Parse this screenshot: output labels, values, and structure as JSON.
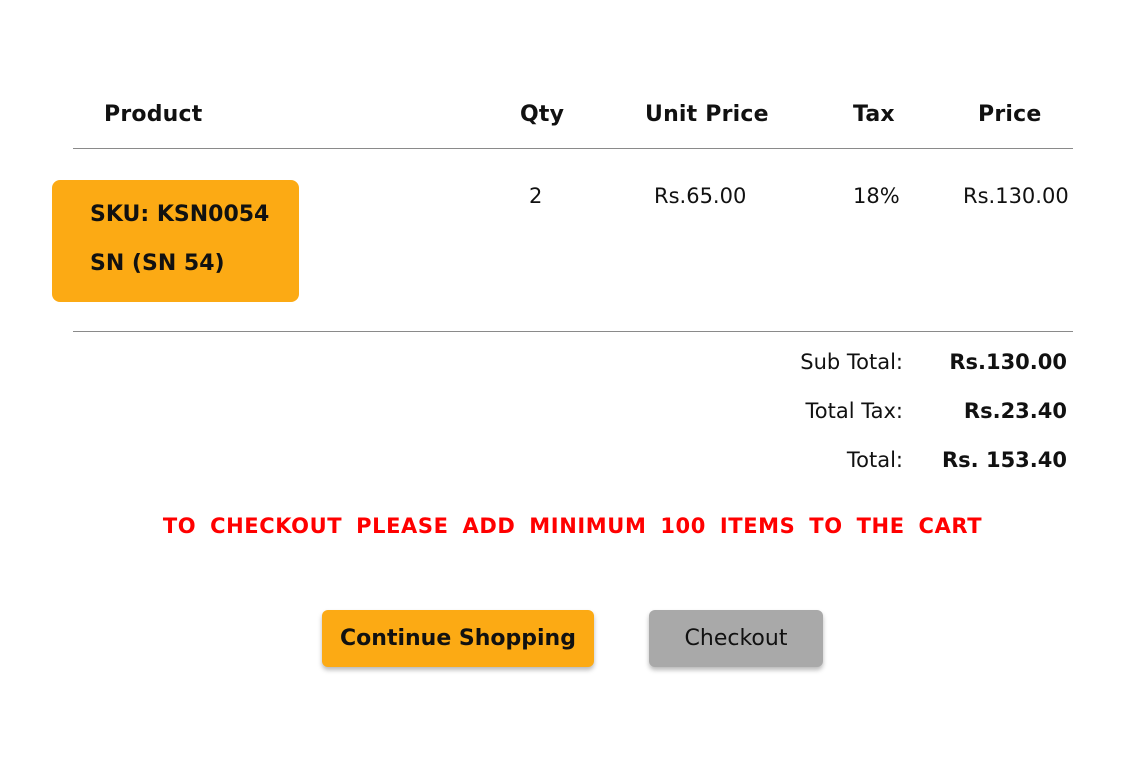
{
  "table": {
    "headers": {
      "product": "Product",
      "qty": "Qty",
      "unit_price": "Unit Price",
      "tax": "Tax",
      "price": "Price"
    },
    "rows": [
      {
        "sku": "SKU: KSN0054",
        "name": "SN (SN 54)",
        "qty": "2",
        "unit_price": "Rs.65.00",
        "tax": "18%",
        "price": "Rs.130.00"
      }
    ]
  },
  "summary": {
    "subtotal_label": "Sub Total:",
    "subtotal_value": "Rs.130.00",
    "tax_label": "Total Tax:",
    "tax_value": "Rs.23.40",
    "total_label": "Total:",
    "total_value": "Rs. 153.40"
  },
  "notice": "TO CHECKOUT PLEASE ADD MINIMUM 100 ITEMS TO THE CART",
  "buttons": {
    "continue_label": "Continue Shopping",
    "checkout_label": "Checkout"
  },
  "colors": {
    "accent": "#fcaa14",
    "warning": "#ff0000",
    "disabled_button": "#a9a9a9"
  }
}
